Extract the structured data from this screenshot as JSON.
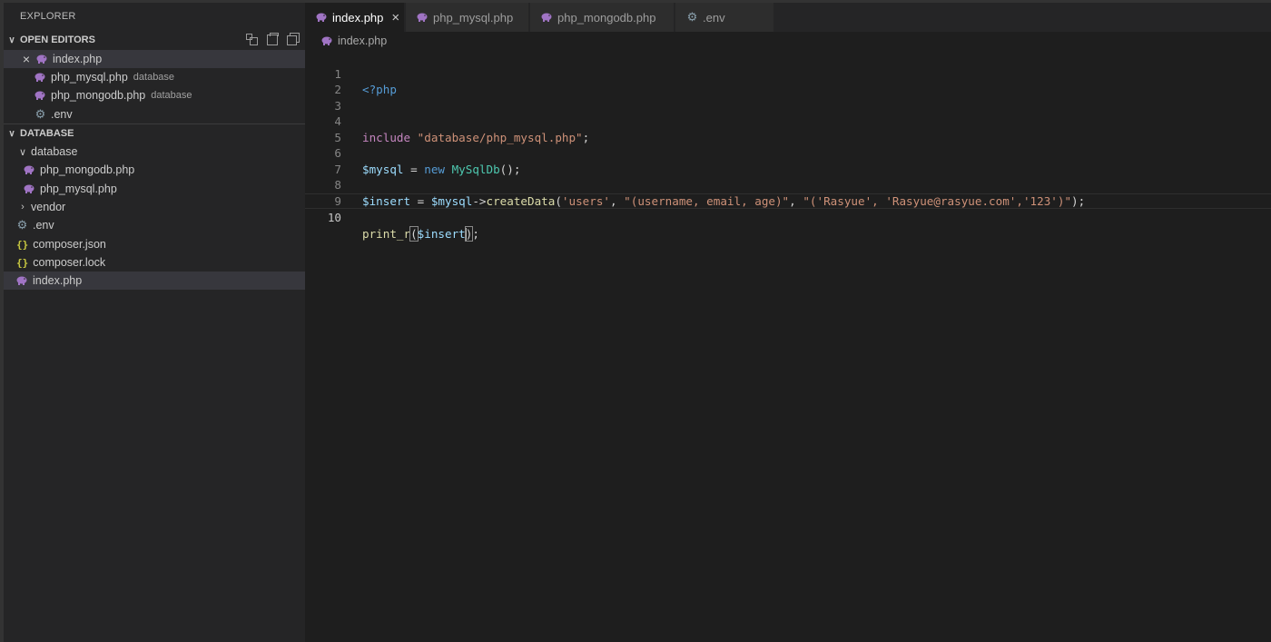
{
  "sidebar": {
    "title": "EXPLORER",
    "open_editors": {
      "header": "OPEN EDITORS",
      "items": [
        {
          "label": "index.php",
          "meta": ""
        },
        {
          "label": "php_mysql.php",
          "meta": "database"
        },
        {
          "label": "php_mongodb.php",
          "meta": "database"
        },
        {
          "label": ".env",
          "meta": ""
        }
      ]
    },
    "project": {
      "header": "DATABASE",
      "items": [
        {
          "label": "database"
        },
        {
          "label": "php_mongodb.php"
        },
        {
          "label": "php_mysql.php"
        },
        {
          "label": "vendor"
        },
        {
          "label": ".env"
        },
        {
          "label": "composer.json"
        },
        {
          "label": "composer.lock"
        },
        {
          "label": "index.php"
        }
      ]
    }
  },
  "tabs": [
    {
      "label": "index.php"
    },
    {
      "label": "php_mysql.php"
    },
    {
      "label": "php_mongodb.php"
    },
    {
      "label": ".env"
    }
  ],
  "breadcrumb": "index.php",
  "editor": {
    "line_numbers": [
      "1",
      "2",
      "3",
      "4",
      "5",
      "6",
      "7",
      "8",
      "9",
      "10"
    ],
    "lines": {
      "l1_open": "<?php",
      "l4_include": "include",
      "l4_path": "\"database/php_mysql.php\"",
      "l6_var": "$mysql",
      "l6_eq": " = ",
      "l6_new": "new",
      "l6_class": "MySqlDb",
      "l6_end": "();",
      "l8_var": "$insert",
      "l8_eq": " = ",
      "l8_obj": "$mysql",
      "l8_arrow": "->",
      "l8_fn": "createData",
      "l8_p1": "(",
      "l8_a1": "'users'",
      "l8_c1": ", ",
      "l8_a2": "\"(username, email, age)\"",
      "l8_c2": ", ",
      "l8_a3": "\"('Rasyue', 'Rasyue@rasyue.com','123')\"",
      "l8_end": ");",
      "l10_fn": "print_r",
      "l10_open": "(",
      "l10_var": "$insert",
      "l10_close": ")",
      "l10_end": ";"
    }
  },
  "colors": {
    "editor_bg": "#1e1e1e",
    "sidebar_bg": "#252526",
    "php_icon": "#a074c4",
    "json_icon": "#cbcb41"
  }
}
